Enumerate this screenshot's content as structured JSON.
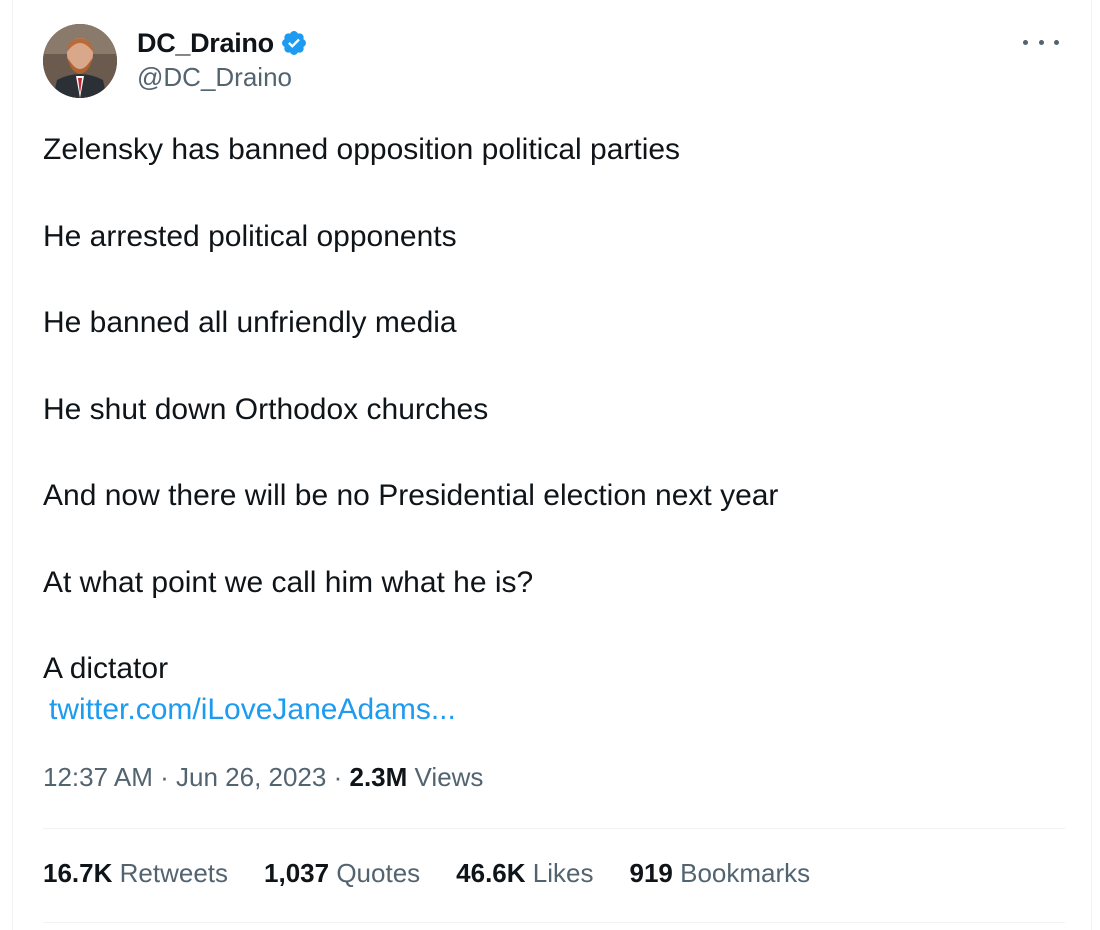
{
  "author": {
    "display_name": "DC_Draino",
    "handle": "@DC_Draino",
    "verified": true,
    "verified_icon": "verified-badge-icon",
    "avatar_icon": "user-avatar"
  },
  "more_icon": "more-options-icon",
  "tweet": {
    "lines": [
      "Zelensky has banned opposition political parties",
      "He arrested political opponents",
      "He banned all unfriendly media",
      "He shut down Orthodox churches",
      "And now there will be no Presidential election next year",
      "At what point we call him what he is?",
      "A dictator"
    ],
    "link": "twitter.com/iLoveJaneAdams..."
  },
  "meta": {
    "time": "12:37 AM",
    "separator": "·",
    "date": "Jun 26, 2023",
    "views_count": "2.3M",
    "views_label": "Views"
  },
  "stats": {
    "retweets": {
      "count": "16.7K",
      "label": "Retweets"
    },
    "quotes": {
      "count": "1,037",
      "label": "Quotes"
    },
    "likes": {
      "count": "46.6K",
      "label": "Likes"
    },
    "bookmarks": {
      "count": "919",
      "label": "Bookmarks"
    }
  },
  "colors": {
    "link": "#1d9bf0",
    "verified": "#1d9bf0",
    "text_primary": "#0f1419",
    "text_secondary": "#536471",
    "divider": "#eff3f4"
  }
}
